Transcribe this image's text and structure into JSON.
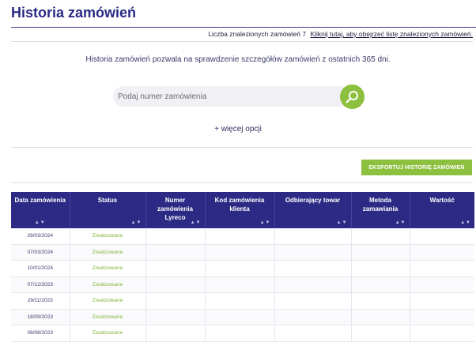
{
  "page": {
    "title": "Historia zamówień",
    "results_label": "Liczba znalezionych zamówień 7",
    "results_link": "Kliknij tutaj, aby obejrzeć listę znalezionych zamówień.",
    "intro_text": "Historia zamówień pozwala na sprawdzenie szczegółów zamówień z ostatnich 365 dni."
  },
  "search": {
    "placeholder": "Podaj numer zamówienia",
    "value": "",
    "button_icon": "search-icon"
  },
  "more_options_label": "+ więcej opcji",
  "export_label": "EKSPORTUJ HISTORIĘ ZAMÓWIEŃ",
  "table": {
    "columns": [
      "Data zamówienia",
      "Status",
      "Numer zamówienia Lyreco",
      "Kod zamówienia klienta",
      "Odbierający towar",
      "Metoda zamawiania",
      "Wartość"
    ],
    "rows": [
      {
        "date": "29/03/2024",
        "status": "Zrealizowane"
      },
      {
        "date": "07/03/2024",
        "status": "Zrealizowane"
      },
      {
        "date": "10/01/2024",
        "status": "Zrealizowane"
      },
      {
        "date": "07/12/2023",
        "status": "Zrealizowane"
      },
      {
        "date": "29/11/2023",
        "status": "Zrealizowane"
      },
      {
        "date": "18/09/2023",
        "status": "Zrealizowane"
      },
      {
        "date": "08/08/2023",
        "status": "Zrealizowane"
      }
    ]
  },
  "colors": {
    "brand_navy": "#2d2a85",
    "accent_green": "#8dc03f",
    "status_green": "#7db53a"
  }
}
